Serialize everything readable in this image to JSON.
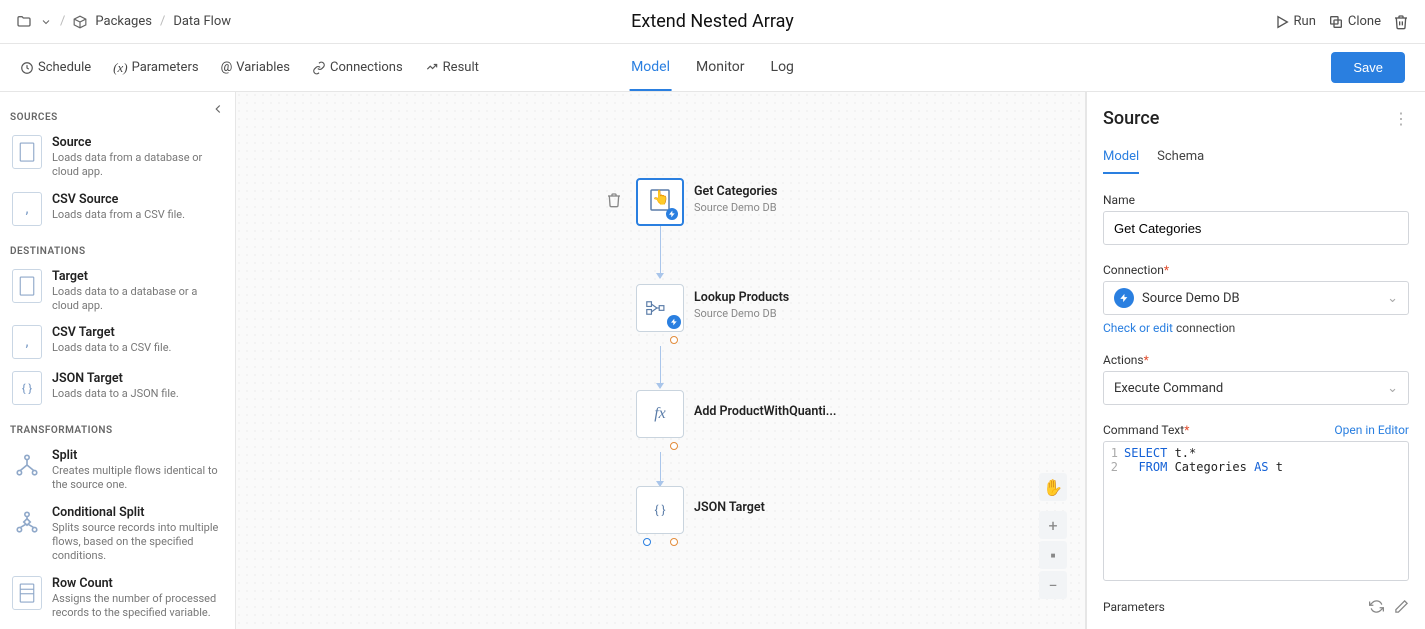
{
  "breadcrumb": {
    "packages": "Packages",
    "dataflow": "Data Flow"
  },
  "page_title": "Extend Nested Array",
  "top_actions": {
    "run": "Run",
    "clone": "Clone"
  },
  "subbar": {
    "schedule": "Schedule",
    "parameters": "Parameters",
    "variables": "Variables",
    "connections": "Connections",
    "result": "Result"
  },
  "center_tabs": {
    "model": "Model",
    "monitor": "Monitor",
    "log": "Log"
  },
  "save_btn": "Save",
  "left_panel": {
    "groups": {
      "sources": {
        "header": "SOURCES",
        "items": [
          {
            "title": "Source",
            "desc": "Loads data from a database or cloud app."
          },
          {
            "title": "CSV Source",
            "desc": "Loads data from a CSV file."
          }
        ]
      },
      "destinations": {
        "header": "DESTINATIONS",
        "items": [
          {
            "title": "Target",
            "desc": "Loads data to a database or a cloud app."
          },
          {
            "title": "CSV Target",
            "desc": "Loads data to a CSV file."
          },
          {
            "title": "JSON Target",
            "desc": "Loads data to a JSON file."
          }
        ]
      },
      "transformations": {
        "header": "TRANSFORMATIONS",
        "items": [
          {
            "title": "Split",
            "desc": "Creates multiple flows identical to the source one."
          },
          {
            "title": "Conditional Split",
            "desc": "Splits source records into multiple flows, based on the specified conditions."
          },
          {
            "title": "Row Count",
            "desc": "Assigns the number of processed records to the specified variable."
          }
        ]
      }
    }
  },
  "canvas": {
    "nodes": [
      {
        "id": "n1",
        "title": "Get Categories",
        "sub": "Source Demo DB"
      },
      {
        "id": "n2",
        "title": "Lookup Products",
        "sub": "Source Demo DB"
      },
      {
        "id": "n3",
        "title": "Add ProductWithQuanti...",
        "sub": ""
      },
      {
        "id": "n4",
        "title": "JSON Target",
        "sub": ""
      }
    ]
  },
  "inspector": {
    "title": "Source",
    "tabs": {
      "model": "Model",
      "schema": "Schema"
    },
    "name_label": "Name",
    "name_value": "Get Categories",
    "connection_label": "Connection",
    "connection_value": "Source Demo DB",
    "check_edit_prefix": "Check or edit",
    "check_edit_suffix": " connection",
    "actions_label": "Actions",
    "actions_value": "Execute Command",
    "command_label": "Command Text",
    "open_editor": "Open in Editor",
    "code": {
      "l1_select": "SELECT ",
      "l1_rest": "t.*",
      "l2_pad": "  ",
      "l2_from": "FROM ",
      "l2_mid": "Categories ",
      "l2_as": "AS ",
      "l2_t": "t"
    },
    "params_label": "Parameters"
  }
}
